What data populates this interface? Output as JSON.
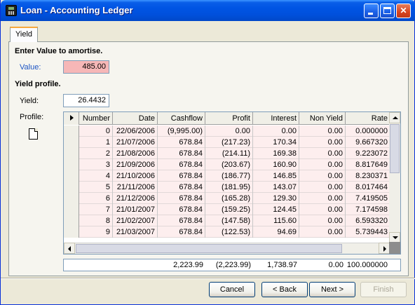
{
  "window": {
    "title": "Loan - Accounting Ledger"
  },
  "tabs": [
    {
      "label": "Yield"
    }
  ],
  "amortise": {
    "heading": "Enter Value to amortise.",
    "value_label": "Value:",
    "value": "485.00"
  },
  "yield_profile": {
    "heading": "Yield profile.",
    "yield_label": "Yield:",
    "yield_value": "26.4432",
    "profile_label": "Profile:"
  },
  "grid": {
    "columns": [
      "Number",
      "Date",
      "Cashflow",
      "Profit",
      "Interest",
      "Non Yield",
      "Rate"
    ],
    "rows": [
      [
        "0",
        "22/06/2006",
        "(9,995.00)",
        "0.00",
        "0.00",
        "0.00",
        "0.000000"
      ],
      [
        "1",
        "21/07/2006",
        "678.84",
        "(217.23)",
        "170.34",
        "0.00",
        "9.667320"
      ],
      [
        "2",
        "21/08/2006",
        "678.84",
        "(214.11)",
        "169.38",
        "0.00",
        "9.223072"
      ],
      [
        "3",
        "21/09/2006",
        "678.84",
        "(203.67)",
        "160.90",
        "0.00",
        "8.817649"
      ],
      [
        "4",
        "21/10/2006",
        "678.84",
        "(186.77)",
        "146.85",
        "0.00",
        "8.230371"
      ],
      [
        "5",
        "21/11/2006",
        "678.84",
        "(181.95)",
        "143.07",
        "0.00",
        "8.017464"
      ],
      [
        "6",
        "21/12/2006",
        "678.84",
        "(165.28)",
        "129.30",
        "0.00",
        "7.419505"
      ],
      [
        "7",
        "21/01/2007",
        "678.84",
        "(159.25)",
        "124.45",
        "0.00",
        "7.174598"
      ],
      [
        "8",
        "21/02/2007",
        "678.84",
        "(147.58)",
        "115.60",
        "0.00",
        "6.593320"
      ],
      [
        "9",
        "21/03/2007",
        "678.84",
        "(122.53)",
        "94.69",
        "0.00",
        "5.739443"
      ]
    ],
    "totals": [
      "",
      "",
      "2,223.99",
      "(2,223.99)",
      "1,738.97",
      "0.00",
      "100.000000"
    ]
  },
  "buttons": {
    "cancel": "Cancel",
    "back": "< Back",
    "next": "Next >",
    "finish": "Finish"
  }
}
